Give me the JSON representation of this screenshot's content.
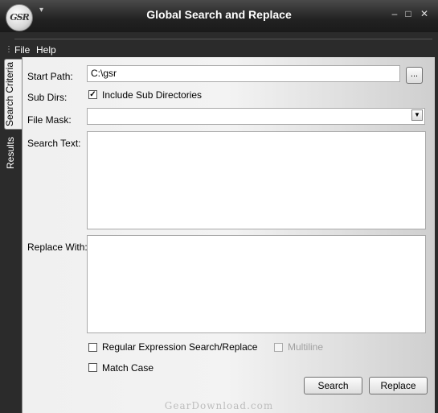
{
  "window": {
    "title": "Global Search and Replace",
    "logo_text": "GSR",
    "minimize_glyph": "–",
    "maximize_glyph": "□",
    "close_glyph": "✕",
    "quick_access_glyph": "▾"
  },
  "menu": {
    "items": [
      {
        "label": "File"
      },
      {
        "label": "Help"
      }
    ]
  },
  "tabs": [
    {
      "label": "Search Criteria",
      "active": true
    },
    {
      "label": "Results",
      "active": false
    }
  ],
  "form": {
    "start_path": {
      "label": "Start Path:",
      "value": "C:\\gsr",
      "browse_label": "..."
    },
    "sub_dirs": {
      "label": "Sub Dirs:",
      "checkbox_label": "Include Sub Directories",
      "checked": true
    },
    "file_mask": {
      "label": "File Mask:",
      "value": ""
    },
    "search_text": {
      "label": "Search Text:",
      "value": ""
    },
    "replace_with": {
      "label": "Replace With:",
      "value": ""
    },
    "options": [
      {
        "label": "Regular Expression Search/Replace",
        "checked": false,
        "enabled": true
      },
      {
        "label": "Multiline",
        "checked": false,
        "enabled": false
      },
      {
        "label": "Match Case",
        "checked": false,
        "enabled": true
      }
    ]
  },
  "buttons": {
    "search": "Search",
    "replace": "Replace"
  },
  "watermark": "GearDownload.com",
  "colors": {
    "titlebar": "#222222",
    "panel": "#f0f0f0",
    "frame": "#2b2b2b"
  }
}
